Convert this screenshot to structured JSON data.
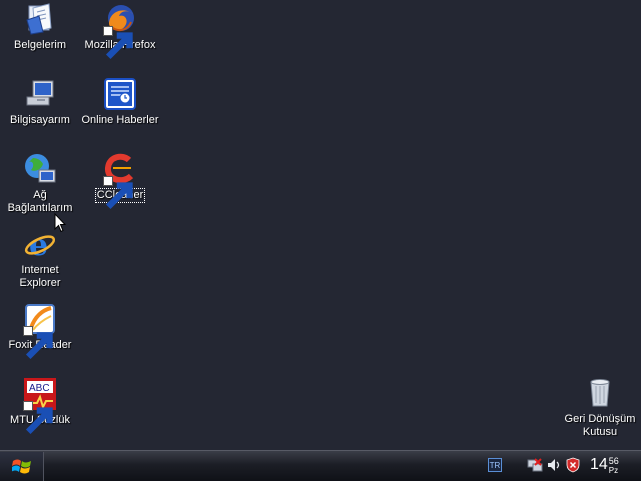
{
  "desktop": {
    "icons": [
      {
        "label": "Belgelerim"
      },
      {
        "label": "Mozilla Firefox"
      },
      {
        "label": "Bilgisayarım"
      },
      {
        "label": "Online Haberler"
      },
      {
        "label": "Ağ Bağlantılarım"
      },
      {
        "label": "CCleaner"
      },
      {
        "label": "Internet Explorer"
      },
      {
        "label": "Foxit Reader"
      },
      {
        "label": "MTU Sözlük"
      },
      {
        "label": "Geri Dönüşüm Kutusu"
      }
    ],
    "selected_icon": "CCleaner"
  },
  "taskbar": {
    "language": "TR",
    "clock": {
      "hour": "14",
      "minute": "56",
      "day": "Pz"
    }
  },
  "colors": {
    "desktop_background": "#242733",
    "taskbar": "#1c1e26",
    "label_text": "#ffffff"
  },
  "icon_names": [
    "documents-icon",
    "firefox-icon",
    "computer-icon",
    "online-news-icon",
    "network-icon",
    "ccleaner-icon",
    "ie-icon",
    "foxit-icon",
    "mtu-dictionary-icon",
    "recycle-bin-icon"
  ]
}
